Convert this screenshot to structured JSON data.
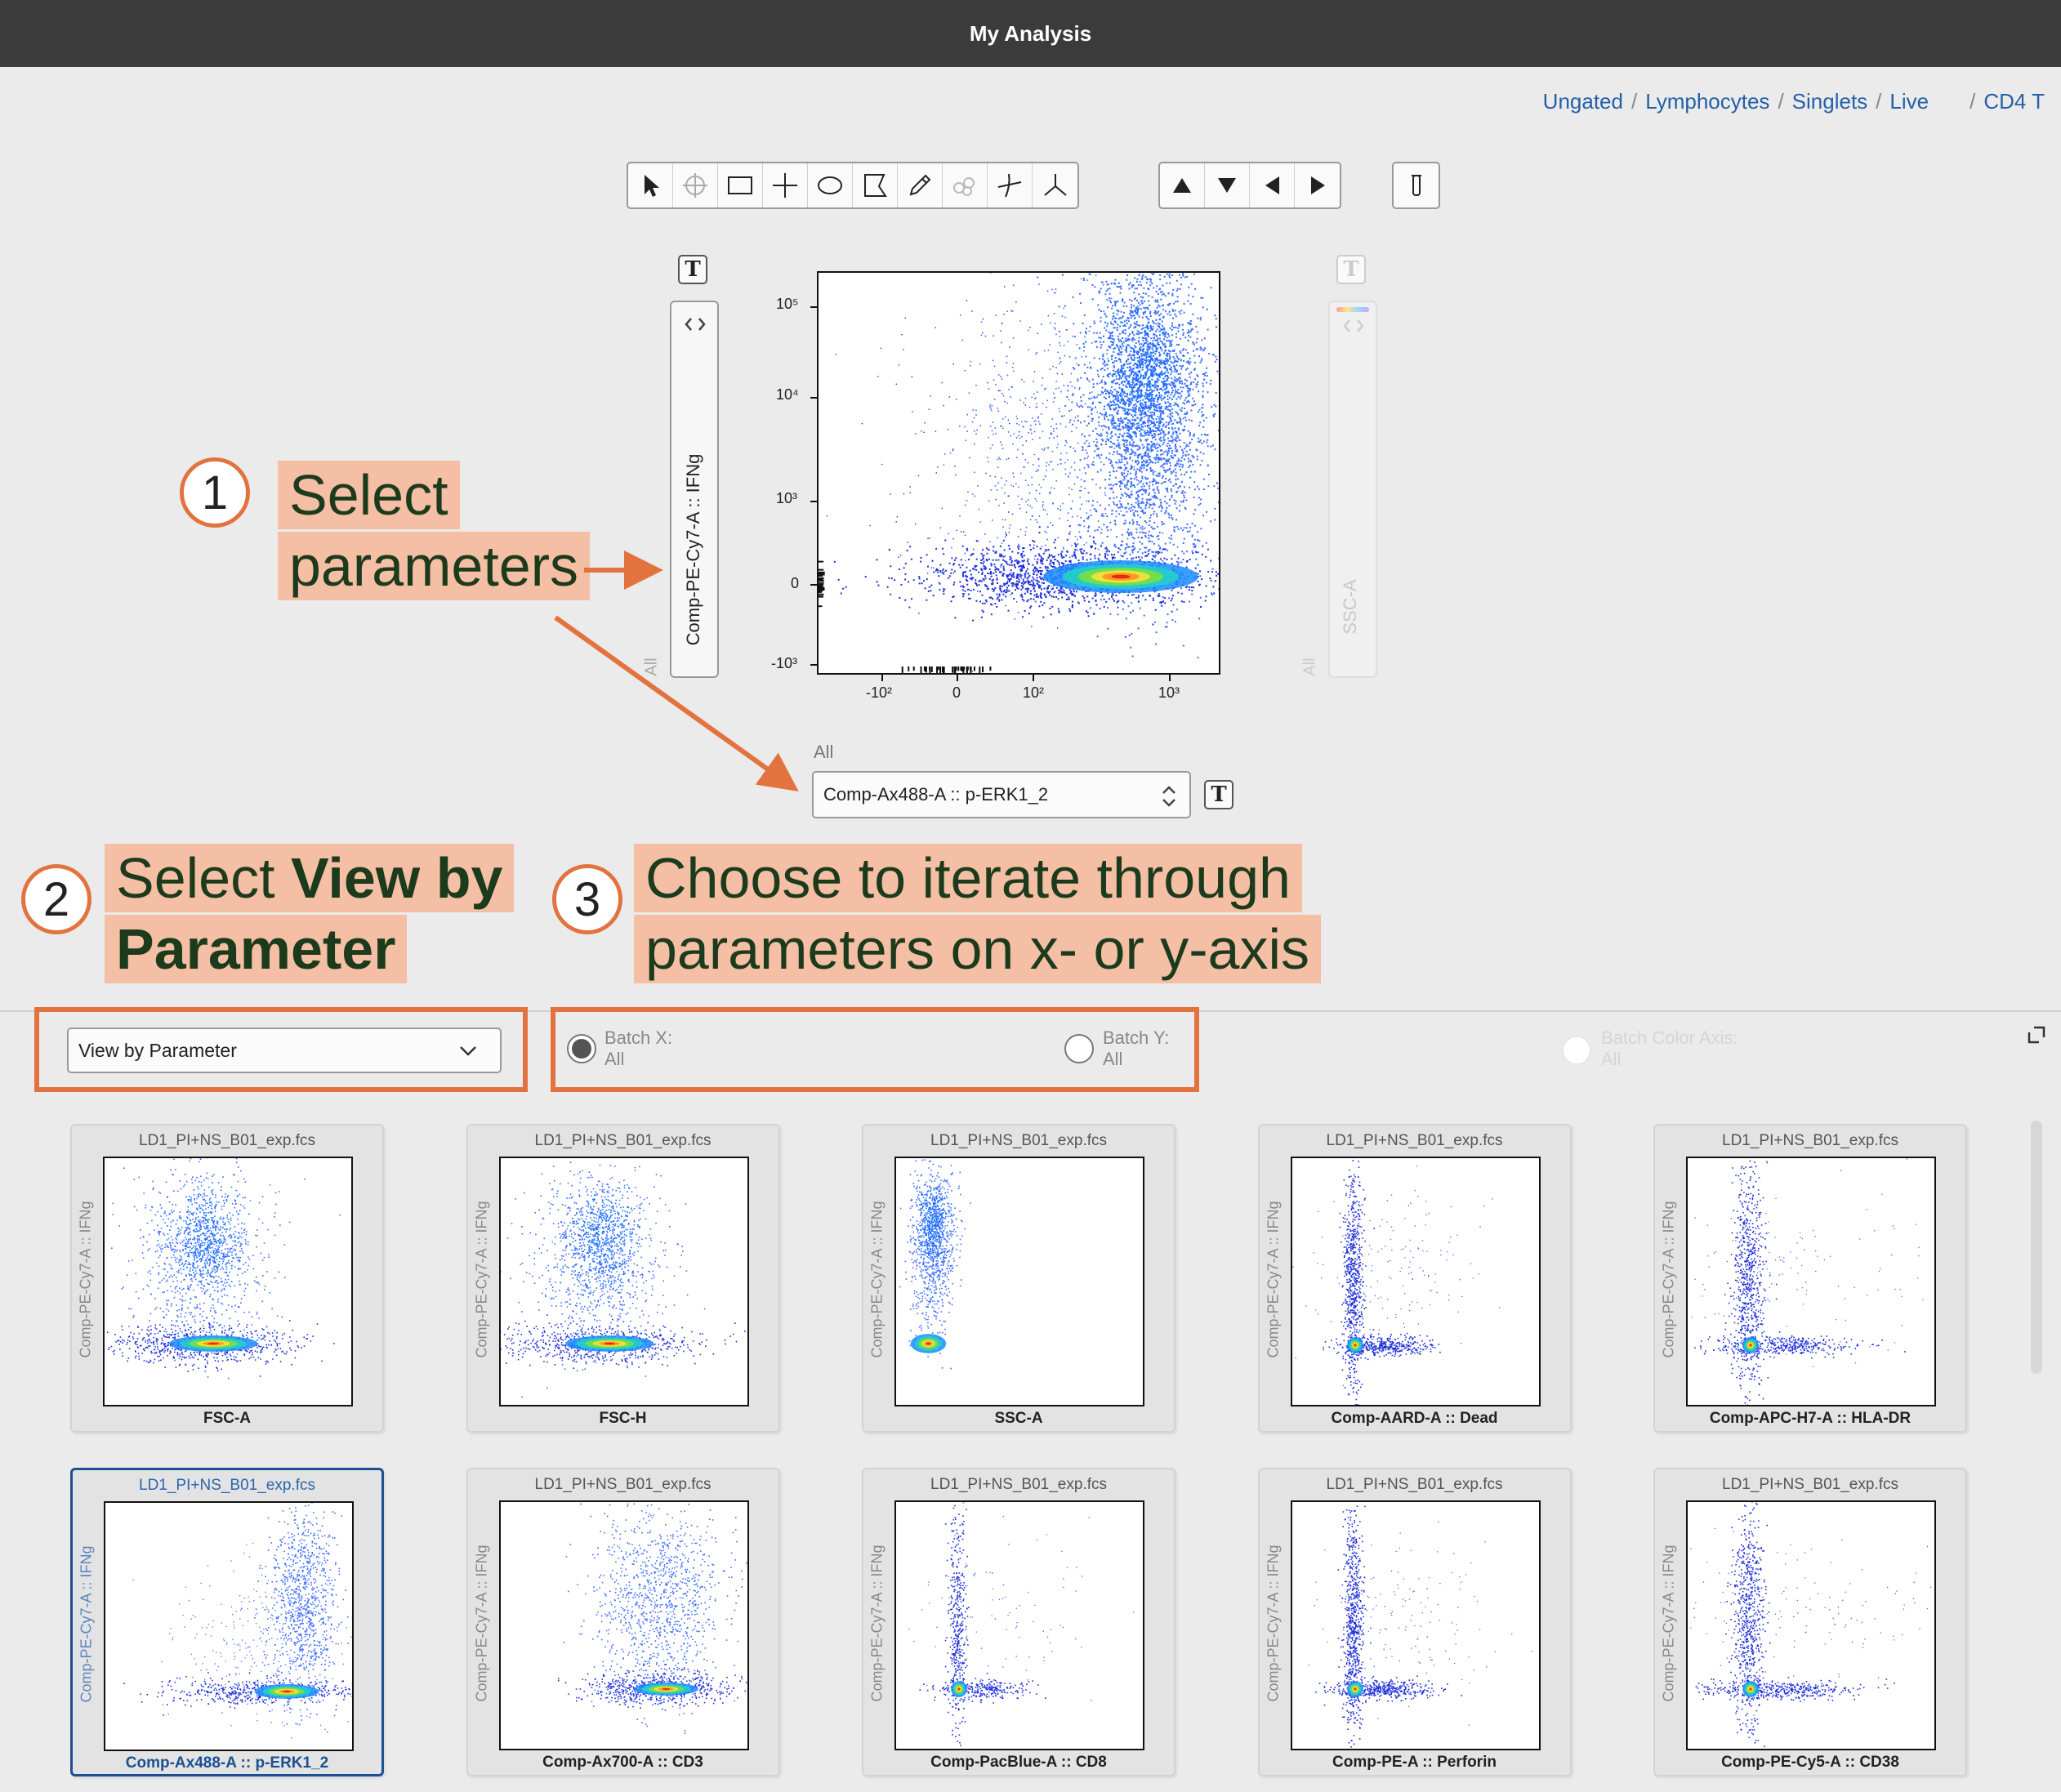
{
  "window": {
    "title": "My Analysis"
  },
  "breadcrumb": [
    "Ungated",
    "Lymphocytes",
    "Singlets",
    "Live",
    "CD4 T"
  ],
  "toolbar": {
    "tools": [
      "pointer-icon",
      "quadrant-circle-icon",
      "rectangle-gate-icon",
      "quadrant-gate-icon",
      "ellipse-gate-icon",
      "polygon-gate-icon",
      "freehand-pencil-icon",
      "spider-gate-icon",
      "curly-quadrant-icon",
      "tri-gate-icon"
    ],
    "nav": [
      "arrow-up-icon",
      "arrow-down-icon",
      "arrow-left-icon",
      "arrow-right-icon"
    ],
    "extra": "tube-icon"
  },
  "main_plot": {
    "y_param": "Comp-PE-Cy7-A :: IFNg",
    "y_label_all": "All",
    "color_param": "SSC-A",
    "color_label_all": "All",
    "x_param": "Comp-Ax488-A :: p-ERK1_2",
    "x_label_all": "All",
    "y_ticks": [
      "10⁵",
      "10⁴",
      "10³",
      "0",
      "-10³"
    ],
    "x_ticks": [
      "-10²",
      "0",
      "10²",
      "10³"
    ],
    "text_toggle": "T"
  },
  "annotations": {
    "step1_number": "1",
    "step1_line1": "Select",
    "step1_line2": "parameters",
    "step2_number": "2",
    "step2_line1_pre": "Select ",
    "step2_line1_bold": "View by",
    "step2_line2_bold": "Parameter",
    "step3_number": "3",
    "step3_line1": "Choose to iterate through",
    "step3_line2": "parameters on x- or y-axis"
  },
  "batch": {
    "view_mode": "View by Parameter",
    "batch_x_label": "Batch X:",
    "batch_x_value": "All",
    "batch_y_label": "Batch Y:",
    "batch_y_value": "All",
    "batch_color_label": "Batch Color Axis:",
    "batch_color_value": "All",
    "selected_radio": "batch_x"
  },
  "thumbnails": [
    {
      "file": "LD1_PI+NS_B01_exp.fcs",
      "y": "Comp-PE-Cy7-A :: IFNg",
      "x": "FSC-A",
      "shape": "fsc"
    },
    {
      "file": "LD1_PI+NS_B01_exp.fcs",
      "y": "Comp-PE-Cy7-A :: IFNg",
      "x": "FSC-H",
      "shape": "fsc"
    },
    {
      "file": "LD1_PI+NS_B01_exp.fcs",
      "y": "Comp-PE-Cy7-A :: IFNg",
      "x": "SSC-A",
      "shape": "ssc"
    },
    {
      "file": "LD1_PI+NS_B01_exp.fcs",
      "y": "Comp-PE-Cy7-A :: IFNg",
      "x": "Comp-AARD-A :: Dead",
      "shape": "L"
    },
    {
      "file": "LD1_PI+NS_B01_exp.fcs",
      "y": "Comp-PE-Cy7-A :: IFNg",
      "x": "Comp-APC-H7-A :: HLA-DR",
      "shape": "Lwide"
    },
    {
      "file": "LD1_PI+NS_B01_exp.fcs",
      "y": "Comp-PE-Cy7-A :: IFNg",
      "x": "Comp-Ax488-A :: p-ERK1_2",
      "shape": "erk",
      "selected": true
    },
    {
      "file": "LD1_PI+NS_B01_exp.fcs",
      "y": "Comp-PE-Cy7-A :: IFNg",
      "x": "Comp-Ax700-A :: CD3",
      "shape": "cd3"
    },
    {
      "file": "LD1_PI+NS_B01_exp.fcs",
      "y": "Comp-PE-Cy7-A :: IFNg",
      "x": "Comp-PacBlue-A :: CD8",
      "shape": "Lsparse"
    },
    {
      "file": "LD1_PI+NS_B01_exp.fcs",
      "y": "Comp-PE-Cy7-A :: IFNg",
      "x": "Comp-PE-A :: Perforin",
      "shape": "L"
    },
    {
      "file": "LD1_PI+NS_B01_exp.fcs",
      "y": "Comp-PE-Cy7-A :: IFNg",
      "x": "Comp-PE-Cy5-A :: CD38",
      "shape": "Lwide"
    }
  ],
  "colors": {
    "accent_orange": "#e2733e",
    "highlight": "#f4bfa4",
    "link_blue": "#2460a7",
    "selected_border": "#1d4f93"
  }
}
